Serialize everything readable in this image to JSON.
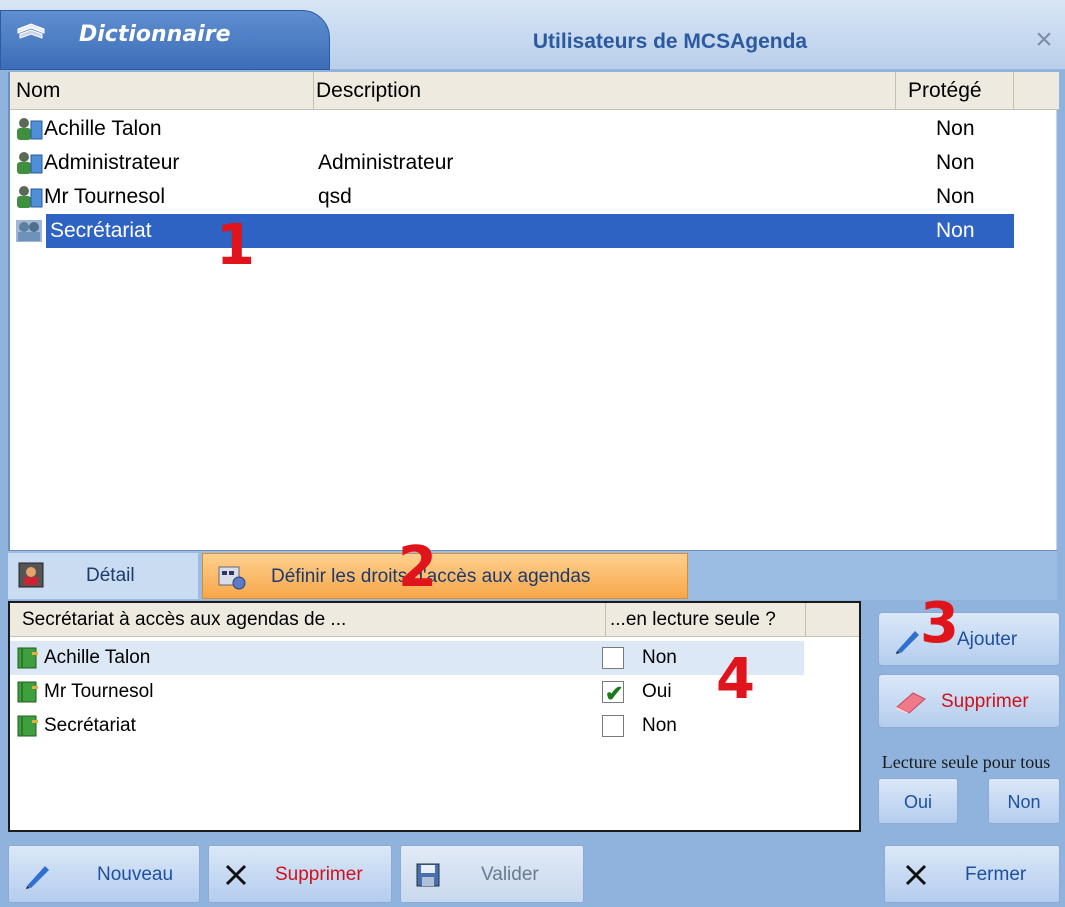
{
  "window": {
    "tab_label": "Dictionnaire",
    "title": "Utilisateurs de MCSAgenda",
    "close_glyph": "×"
  },
  "users_table": {
    "columns": [
      "Nom",
      "Description",
      "Protégé"
    ],
    "rows": [
      {
        "name": "Achille Talon",
        "description": "",
        "protected": "Non",
        "icon": "user-icon"
      },
      {
        "name": "Administrateur",
        "description": "Administrateur",
        "protected": "Non",
        "icon": "user-icon"
      },
      {
        "name": "Mr Tournesol",
        "description": "qsd",
        "protected": "Non",
        "icon": "user-icon"
      },
      {
        "name": "Secrétariat",
        "description": "",
        "protected": "Non",
        "icon": "group-icon",
        "selected": true
      }
    ]
  },
  "tabs": [
    {
      "label": "Détail",
      "icon": "user-card-icon"
    },
    {
      "label": "Définir les droits d'accès aux agendas",
      "icon": "access-rights-icon",
      "active": true
    }
  ],
  "access_table": {
    "columns": [
      "Secrétariat à accès aux agendas de ...",
      "...en lecture seule ?"
    ],
    "rows": [
      {
        "name": "Achille Talon",
        "read_only": "Non",
        "checked": false
      },
      {
        "name": "Mr Tournesol",
        "read_only": "Oui",
        "checked": true
      },
      {
        "name": "Secrétariat",
        "read_only": "Non",
        "checked": false
      }
    ]
  },
  "side_buttons": {
    "add": "Ajouter",
    "delete": "Supprimer",
    "readonly_all_label": "Lecture seule pour tous",
    "yes": "Oui",
    "no": "Non"
  },
  "bottom_buttons": {
    "new": "Nouveau",
    "delete": "Supprimer",
    "validate": "Valider",
    "close": "Fermer"
  },
  "annotations": [
    "1",
    "2",
    "3",
    "4"
  ],
  "colors": {
    "selection": "#2e62c3",
    "active_tab": "#f7a74a",
    "annotation": "#e0141b",
    "delete_text": "#d0101a"
  }
}
